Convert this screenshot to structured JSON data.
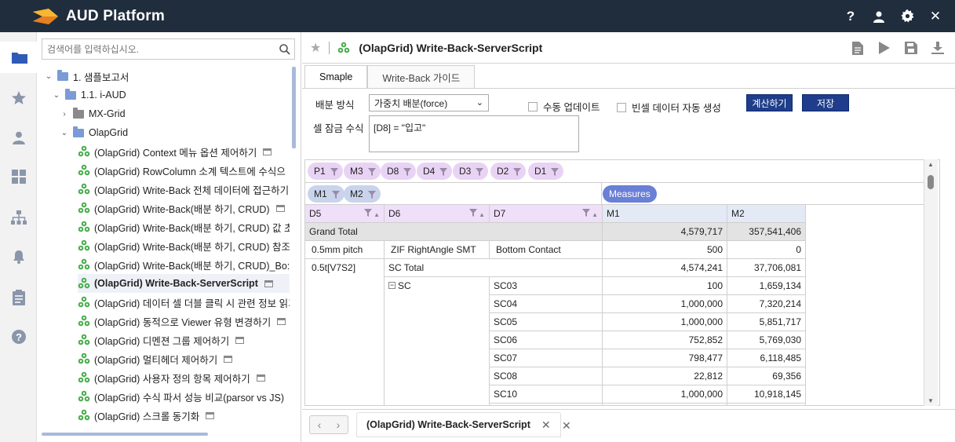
{
  "app": {
    "title": "AUD Platform"
  },
  "header": {
    "icons": [
      "help-icon",
      "user-icon",
      "gear-icon",
      "close-icon"
    ]
  },
  "rail": {
    "icons": [
      "folder-icon",
      "star-icon",
      "person-icon",
      "dashboard-icon",
      "org-chart-icon",
      "bell-icon",
      "clipboard-icon",
      "help-circle-icon"
    ]
  },
  "search": {
    "placeholder": "검색어를 입력하십시오."
  },
  "tree": {
    "items": [
      {
        "label": "1. 샘플보고서",
        "level": 0,
        "kind": "folder",
        "open": true
      },
      {
        "label": "1.1. i-AUD",
        "level": 1,
        "kind": "folder",
        "open": true
      },
      {
        "label": "MX-Grid",
        "level": 2,
        "kind": "folder-gray",
        "open": false
      },
      {
        "label": "OlapGrid",
        "level": 2,
        "kind": "folder",
        "open": true
      },
      {
        "label": "(OlapGrid) Context 메뉴 옵션 제어하기",
        "level": 3,
        "kind": "report",
        "win": true
      },
      {
        "label": "(OlapGrid) RowColumn 소계 텍스트에 수식으",
        "level": 3,
        "kind": "report"
      },
      {
        "label": "(OlapGrid) Write-Back 전체 데이터에 접근하기",
        "level": 3,
        "kind": "report"
      },
      {
        "label": "(OlapGrid) Write-Back(배분 하기, CRUD)",
        "level": 3,
        "kind": "report",
        "win": true
      },
      {
        "label": "(OlapGrid) Write-Back(배분 하기, CRUD) 값 초",
        "level": 3,
        "kind": "report"
      },
      {
        "label": "(OlapGrid) Write-Back(배분 하기, CRUD) 참조",
        "level": 3,
        "kind": "report"
      },
      {
        "label": "(OlapGrid) Write-Back(배분 하기, CRUD)_Bo:",
        "level": 3,
        "kind": "report"
      },
      {
        "label": "(OlapGrid) Write-Back-ServerScript",
        "level": 3,
        "kind": "report",
        "win": true,
        "selected": true
      },
      {
        "label": "(OlapGrid) 데이터 셀 더블 클릭 시 관련 정보 읽기",
        "level": 3,
        "kind": "report"
      },
      {
        "label": "(OlapGrid) 동적으로 Viewer 유형 변경하기",
        "level": 3,
        "kind": "report",
        "win": true
      },
      {
        "label": "(OlapGrid) 디멘젼 그룹 제어하기",
        "level": 3,
        "kind": "report",
        "win": true
      },
      {
        "label": "(OlapGrid) 멀티헤더 제어하기",
        "level": 3,
        "kind": "report",
        "win": true
      },
      {
        "label": "(OlapGrid) 사용자 정의 항목 제어하기",
        "level": 3,
        "kind": "report",
        "win": true
      },
      {
        "label": "(OlapGrid) 수식 파서 성능 비교(parsor vs JS)",
        "level": 3,
        "kind": "report"
      },
      {
        "label": "(OlapGrid) 스크롤 동기화",
        "level": 3,
        "kind": "report",
        "win": true
      }
    ]
  },
  "document": {
    "title": "(OlapGrid) Write-Back-ServerScript",
    "toolbar_icons": [
      "document-icon",
      "play-icon",
      "save-icon",
      "download-icon"
    ]
  },
  "tabs": [
    {
      "label": "Smaple",
      "active": true
    },
    {
      "label": "Write-Back 가이드",
      "active": false
    }
  ],
  "form": {
    "dist_label": "배분 방식",
    "dist_value": "가중치 배분(force)",
    "manual_update": "수동 업데이트",
    "auto_blank": "빈셀 데이터 자동 생성",
    "calc_button": "계산하기",
    "save_button": "저장",
    "lock_label": "셀 잠금 수식",
    "lock_formula": "[D8] = \"입고\""
  },
  "grid": {
    "filter_dims": [
      "P1",
      "M3",
      "D8",
      "D4",
      "D3",
      "D2",
      "D1"
    ],
    "row_measures": [
      "M1",
      "M2"
    ],
    "measures_label": "Measures",
    "headers": [
      "D5",
      "D6",
      "D7",
      "M1",
      "M2"
    ],
    "grand_total": {
      "label": "Grand Total",
      "m1": "4,579,717",
      "m2": "357,541,406"
    },
    "row_05": {
      "d5": "0.5mm pitch",
      "d6": "ZIF RightAngle SMT",
      "d7": "Bottom Contact",
      "m1": "500",
      "m2": "0"
    },
    "row_total": {
      "d5": "0.5t[V7S2]",
      "d6": "SC Total",
      "m1": "4,574,241",
      "m2": "37,706,081"
    },
    "sc_label": "SC",
    "sc_rows": [
      {
        "d7": "SC03",
        "m1": "100",
        "m2": "1,659,134"
      },
      {
        "d7": "SC04",
        "m1": "1,000,000",
        "m2": "7,320,214"
      },
      {
        "d7": "SC05",
        "m1": "1,000,000",
        "m2": "5,851,717"
      },
      {
        "d7": "SC06",
        "m1": "752,852",
        "m2": "5,769,030"
      },
      {
        "d7": "SC07",
        "m1": "798,477",
        "m2": "6,118,485"
      },
      {
        "d7": "SC08",
        "m1": "22,812",
        "m2": "69,356"
      },
      {
        "d7": "SC10",
        "m1": "1,000,000",
        "m2": "10,918,145"
      }
    ]
  },
  "bottom_tab": {
    "label": "(OlapGrid) Write-Back-ServerScript"
  }
}
